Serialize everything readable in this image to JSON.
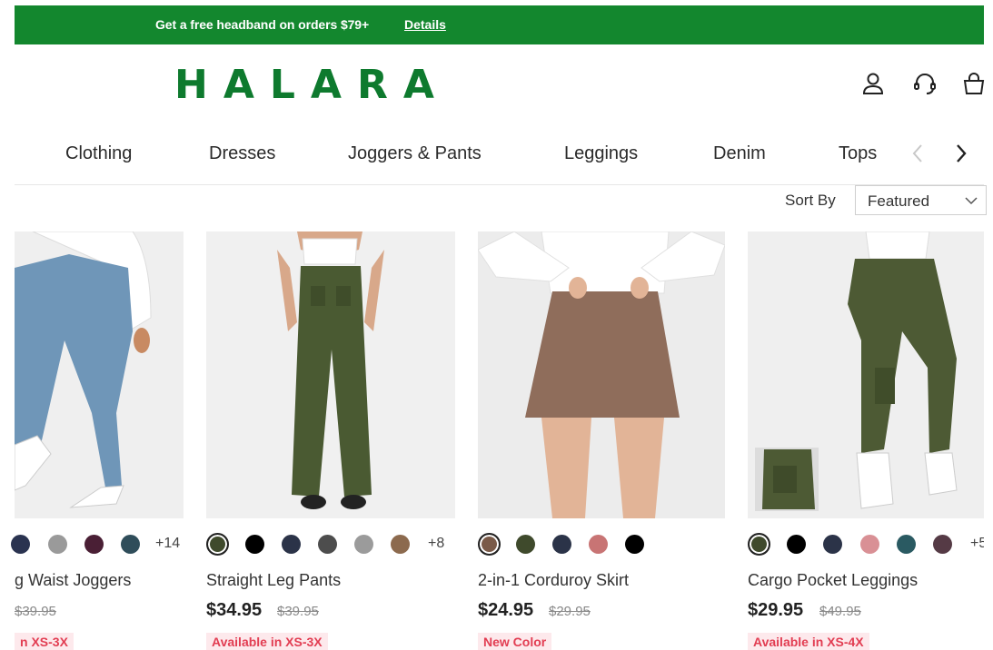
{
  "promo": {
    "text": "Get a free headband on orders $79+",
    "link": "Details"
  },
  "logo": "HALARA",
  "header_icons": [
    "account-icon",
    "support-headset-icon",
    "shopping-bag-icon"
  ],
  "nav": {
    "items": [
      "Clothing",
      "Dresses",
      "Joggers & Pants",
      "Leggings",
      "Denim",
      "Tops"
    ],
    "prev_icon": "chevron-left-icon",
    "next_icon": "chevron-right-icon"
  },
  "sort": {
    "label": "Sort By",
    "value": "Featured"
  },
  "products": [
    {
      "name": "g Waist Joggers",
      "price": "",
      "old_price": "$39.95",
      "badge": "n XS-3X",
      "more_colors": "+14",
      "swatches": [
        "#2a3350",
        "#9a9a9a",
        "#4a1f35",
        "#2f4d5a"
      ]
    },
    {
      "name": "Straight Leg Pants",
      "price": "$34.95",
      "old_price": "$39.95",
      "badge": "Available in XS-3X",
      "more_colors": "+8",
      "swatches": [
        "#3f4a2c",
        "#000000",
        "#2b3348",
        "#4d4d4d",
        "#9b9b9b",
        "#8c6a4e"
      ]
    },
    {
      "name": "2-in-1 Corduroy Skirt",
      "price": "$24.95",
      "old_price": "$29.95",
      "badge": "New Color",
      "more_colors": "",
      "swatches": [
        "#7a5a48",
        "#3f4a2c",
        "#2b3348",
        "#c87474",
        "#000000"
      ]
    },
    {
      "name": "Cargo Pocket Leggings",
      "price": "$29.95",
      "old_price": "$49.95",
      "badge": "Available in XS-4X",
      "more_colors": "+5",
      "swatches": [
        "#3f4a2c",
        "#000000",
        "#2b3348",
        "#d99095",
        "#2a5a62",
        "#553a45"
      ]
    }
  ],
  "colors": {
    "brand_green": "#0e7a2e",
    "promo_bg": "#13872e",
    "badge_text": "#e23d52",
    "badge_bg": "#fde9ec"
  }
}
